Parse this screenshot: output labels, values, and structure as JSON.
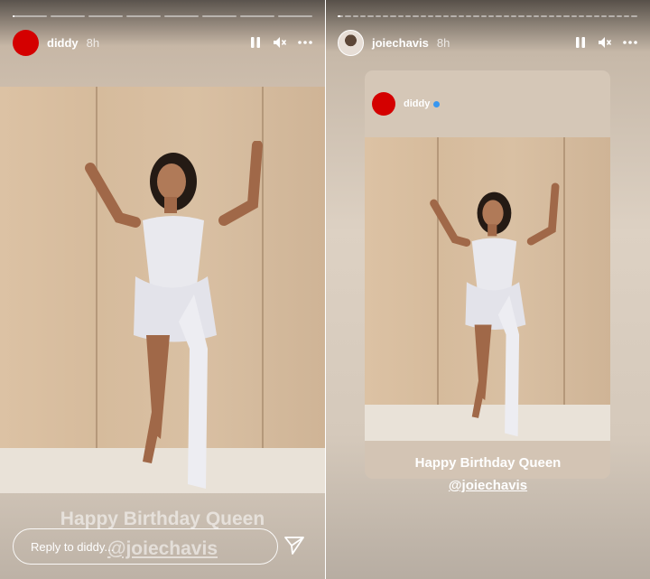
{
  "left_story": {
    "username": "diddy",
    "time": "8h",
    "progress_segments": 8,
    "progress_active_fill": 0.05,
    "caption_line1": "Happy Birthday Queen",
    "caption_line2": "@joiechavis",
    "reply_placeholder": "Reply to diddy...",
    "icons": [
      "pause-icon",
      "mute-icon",
      "more-icon",
      "send-icon"
    ]
  },
  "right_story": {
    "username": "joiechavis",
    "time": "8h",
    "progress_segments": 40,
    "progress_active_fill": 0.5,
    "shared_post_username": "diddy",
    "shared_post_verified": true,
    "caption_line1": "Happy Birthday Queen",
    "caption_line2": "@joiechavis",
    "icons": [
      "pause-icon",
      "mute-icon",
      "more-icon"
    ]
  },
  "colors": {
    "avatar_red": "#d40000",
    "verified_blue": "#3897f0"
  }
}
